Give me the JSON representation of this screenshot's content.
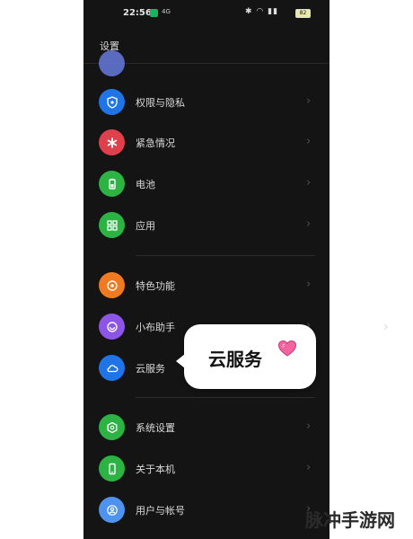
{
  "status_bar": {
    "time": "22:56",
    "network_tag": "4G",
    "battery_text": "82"
  },
  "page": {
    "title": "设置"
  },
  "settings": [
    {
      "label": "权限与隐私",
      "icon": "shield-eye-icon",
      "color": "#1f74e8"
    },
    {
      "label": "紧急情况",
      "icon": "asterisk-icon",
      "color": "#e0404b"
    },
    {
      "label": "电池",
      "icon": "battery-icon",
      "color": "#2cb344"
    },
    {
      "label": "应用",
      "icon": "grid-icon",
      "color": "#2cb344"
    },
    {
      "label": "特色功能",
      "icon": "target-icon",
      "color": "#f07a20"
    },
    {
      "label": "小布助手",
      "icon": "assistant-icon",
      "color": "#8c55e6"
    },
    {
      "label": "云服务",
      "icon": "cloud-icon",
      "color": "#1f74e8"
    },
    {
      "label": "系统设置",
      "icon": "hexagon-icon",
      "color": "#2cb344"
    },
    {
      "label": "关于本机",
      "icon": "phone-icon",
      "color": "#2cb344"
    },
    {
      "label": "用户与帐号",
      "icon": "user-icon",
      "color": "#4e93f0"
    }
  ],
  "callout": {
    "text": "云服务"
  },
  "watermark": {
    "text": "脉冲手游网"
  }
}
